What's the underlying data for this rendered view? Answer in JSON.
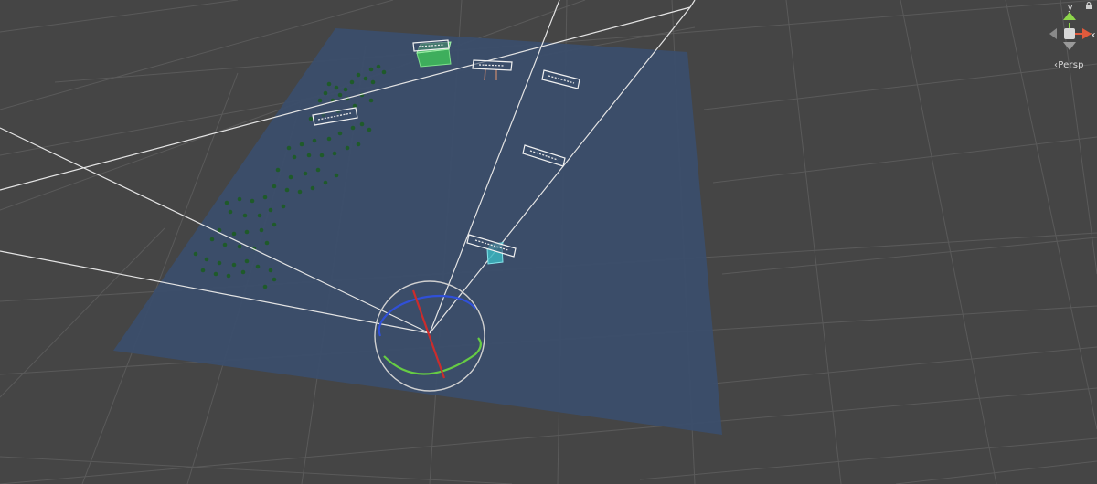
{
  "view": {
    "projection_label": "‹Persp",
    "background": "#454545",
    "grid_color": "#5a5a5a",
    "plane_color": "#3b4e6b"
  },
  "gizmo": {
    "axes": {
      "y": "y",
      "x": "x"
    },
    "colors": {
      "y": "#8ed64b",
      "x": "#e05a3c",
      "z": "#4a7ad9",
      "center": "#d8d8d8"
    }
  },
  "scene_objects": {
    "markers": 6,
    "tree_dots": 77,
    "highlight_colors": {
      "green_box": "#3fbf5a",
      "cyan_cube": "#3bb5c0"
    },
    "rotation_gizmo": {
      "ring": "#d0d0d0",
      "red": "#cc2c2c",
      "green": "#66cc44",
      "blue": "#3050d8"
    }
  },
  "icons": {
    "lock": "lock-icon"
  }
}
